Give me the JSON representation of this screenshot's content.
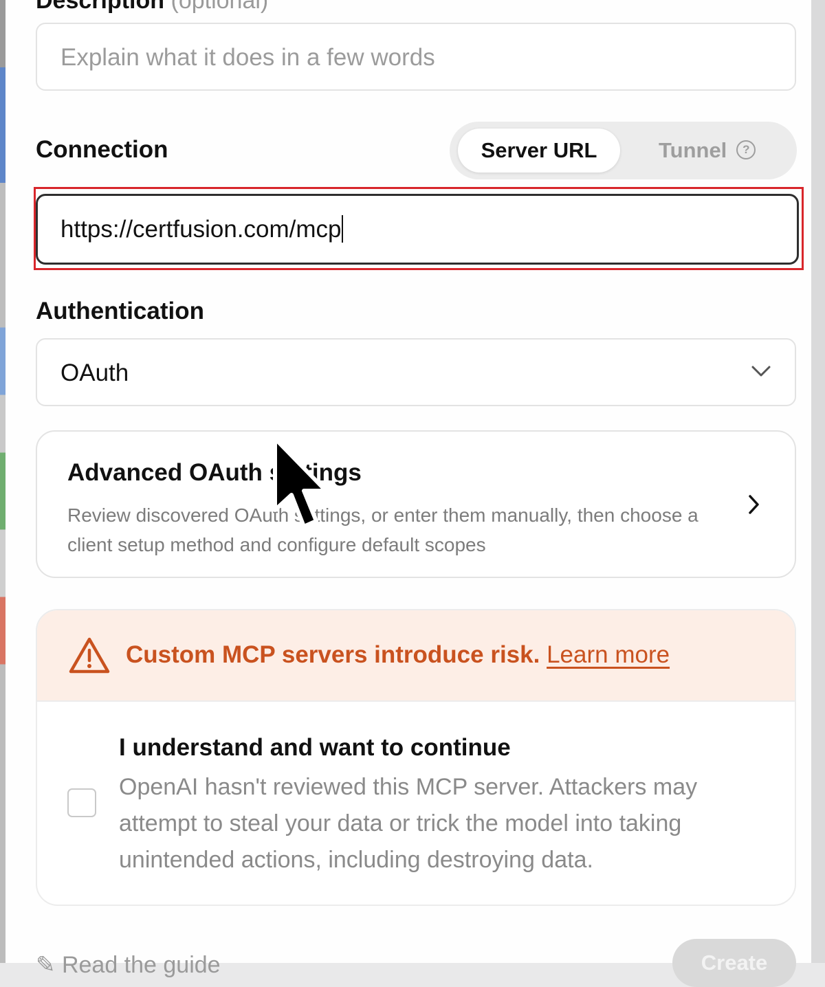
{
  "description_field": {
    "label": "Description",
    "optional_tag": "(optional)",
    "placeholder": "Explain what it does in a few words"
  },
  "connection": {
    "label": "Connection",
    "tabs": [
      {
        "label": "Server URL",
        "selected": true
      },
      {
        "label": "Tunnel",
        "selected": false,
        "icon": "help-icon"
      }
    ],
    "url_value": "https://certfusion.com/mcp"
  },
  "authentication": {
    "label": "Authentication",
    "selected": "OAuth",
    "icon": "chevron-down-icon"
  },
  "advanced_oauth": {
    "title": "Advanced OAuth settings",
    "description": "Review discovered OAuth settings, or enter them manually, then choose a client setup method and configure default scopes",
    "icon": "chevron-right-icon"
  },
  "risk_warning": {
    "icon": "warning-triangle-icon",
    "text": "Custom MCP servers introduce risk.",
    "link": "Learn more",
    "accent": "#c9521f",
    "background": "#fdeee6"
  },
  "acknowledgement": {
    "checked": false,
    "title": "I understand and want to continue",
    "description": "OpenAI hasn't reviewed this MCP server. Attackers may attempt to steal your data or trick the model into taking unintended actions, including destroying data."
  },
  "footer": {
    "link_label": "Read the guide",
    "primary_button": "Create"
  },
  "highlight_color": "#d8262b"
}
